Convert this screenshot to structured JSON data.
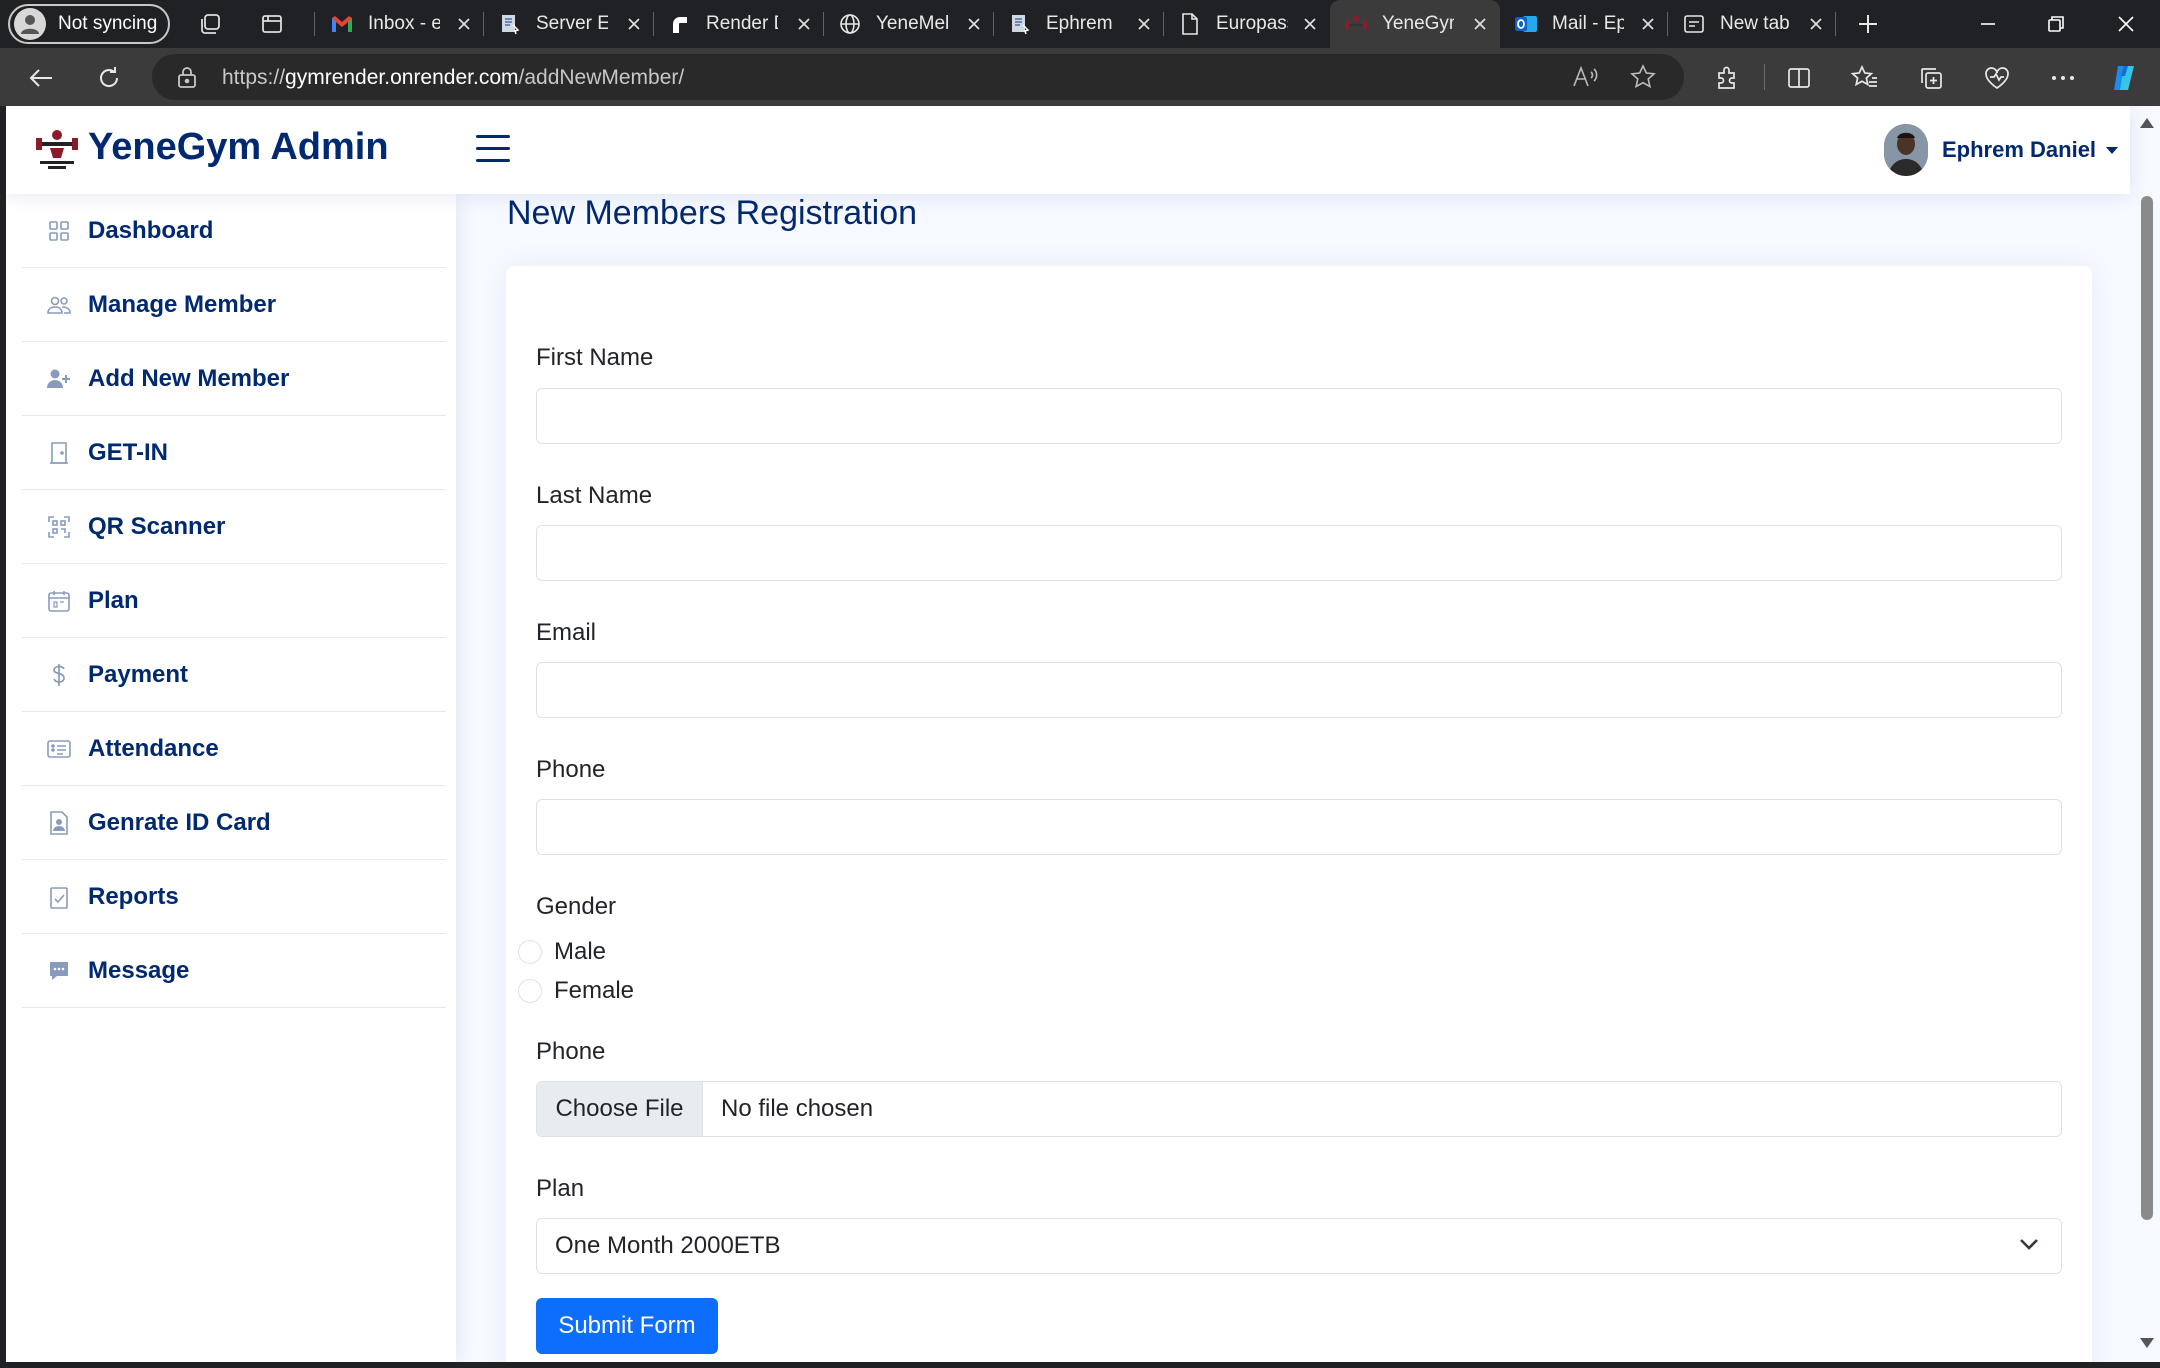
{
  "browser": {
    "profile_label": "Not syncing",
    "tabs": [
      {
        "title": "Inbox - e",
        "icon": "gmail-icon"
      },
      {
        "title": "Server Er",
        "icon": "doc-icon"
      },
      {
        "title": "Render D",
        "icon": "render-icon"
      },
      {
        "title": "YeneMek",
        "icon": "globe-icon"
      },
      {
        "title": "Ephrem I",
        "icon": "doc-icon"
      },
      {
        "title": "Europass",
        "icon": "page-icon"
      },
      {
        "title": "YeneGym",
        "icon": "gym-logo-icon",
        "active": true
      },
      {
        "title": "Mail - Ep",
        "icon": "outlook-icon"
      },
      {
        "title": "New tab",
        "icon": "newtab-icon"
      }
    ],
    "url_prefix": "https://",
    "url_host": "gymrender.onrender.com",
    "url_path": "/addNewMember/"
  },
  "header": {
    "brand": "YeneGym Admin",
    "user_name": "Ephrem Daniel"
  },
  "sidebar": {
    "items": [
      {
        "label": "Dashboard",
        "icon": "grid-icon"
      },
      {
        "label": "Manage Member",
        "icon": "people-icon"
      },
      {
        "label": "Add New Member",
        "icon": "person-plus-icon"
      },
      {
        "label": "GET-IN",
        "icon": "door-icon"
      },
      {
        "label": "QR Scanner",
        "icon": "qr-scan-icon"
      },
      {
        "label": "Plan",
        "icon": "calendar-icon"
      },
      {
        "label": "Payment",
        "icon": "dollar-icon"
      },
      {
        "label": "Attendance",
        "icon": "card-list-icon"
      },
      {
        "label": "Genrate ID Card",
        "icon": "id-card-icon"
      },
      {
        "label": "Reports",
        "icon": "clipboard-check-icon"
      },
      {
        "label": "Message",
        "icon": "chat-icon"
      }
    ]
  },
  "main": {
    "page_title": "New Members Registration",
    "form": {
      "first_name_label": "First Name",
      "first_name_value": "",
      "last_name_label": "Last Name",
      "last_name_value": "",
      "email_label": "Email",
      "email_value": "",
      "phone_label": "Phone",
      "phone_value": "",
      "gender_label": "Gender",
      "gender_options": [
        "Male",
        "Female"
      ],
      "photo_label": "Phone",
      "file_button": "Choose File",
      "file_status": "No file chosen",
      "plan_label": "Plan",
      "plan_selected": "One Month 2000ETB",
      "submit_label": "Submit Form"
    }
  },
  "colors": {
    "brand_navy": "#012970",
    "primary_button": "#0d6efd",
    "page_background": "#f6f9ff"
  }
}
